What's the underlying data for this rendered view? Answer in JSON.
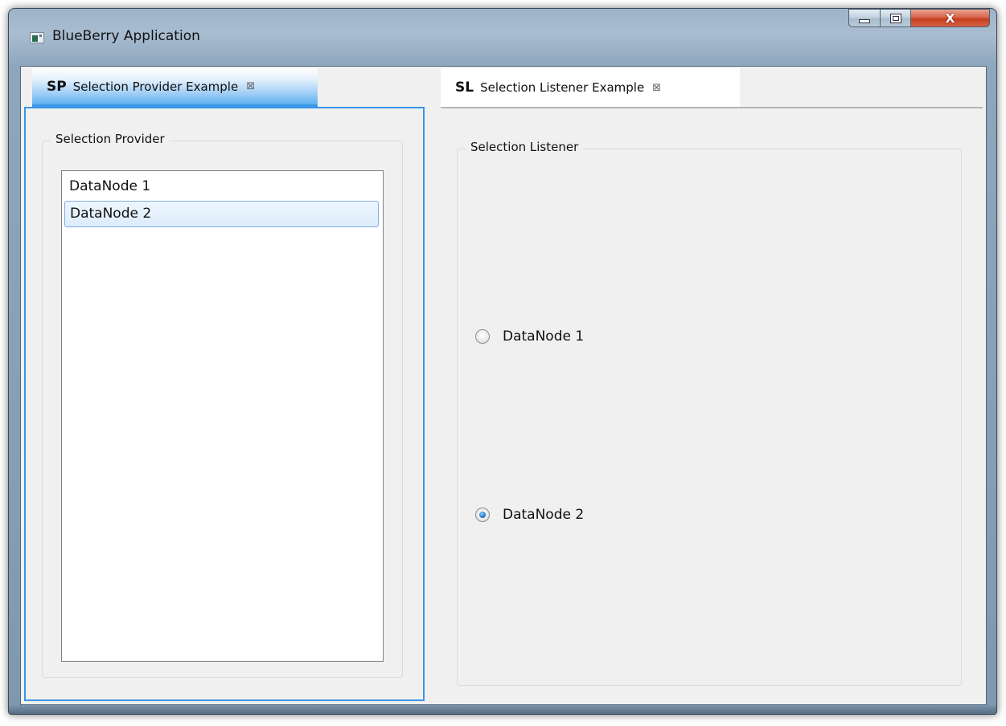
{
  "window": {
    "title": "BlueBerry Application",
    "close_glyph": "X"
  },
  "tabs": [
    {
      "abbr": "SP",
      "label": "Selection Provider Example",
      "close_glyph": "⊠",
      "active": true
    },
    {
      "abbr": "SL",
      "label": "Selection Listener Example",
      "close_glyph": "⊠",
      "active": false
    }
  ],
  "provider_view": {
    "group_title": "Selection Provider",
    "items": [
      {
        "label": "DataNode 1",
        "selected": false
      },
      {
        "label": "DataNode 2",
        "selected": true
      }
    ]
  },
  "listener_view": {
    "group_title": "Selection Listener",
    "radios": [
      {
        "label": "DataNode 1",
        "checked": false
      },
      {
        "label": "DataNode 2",
        "checked": true
      }
    ]
  },
  "colors": {
    "active_tab_accent": "#3b98e7",
    "selection_border": "#84acdd",
    "close_button": "#c23f1f"
  },
  "icons": {
    "app": "app-window-icon",
    "minimize": "minimize-icon",
    "maximize": "maximize-icon",
    "close": "close-icon",
    "tab_close": "tab-close-icon"
  }
}
